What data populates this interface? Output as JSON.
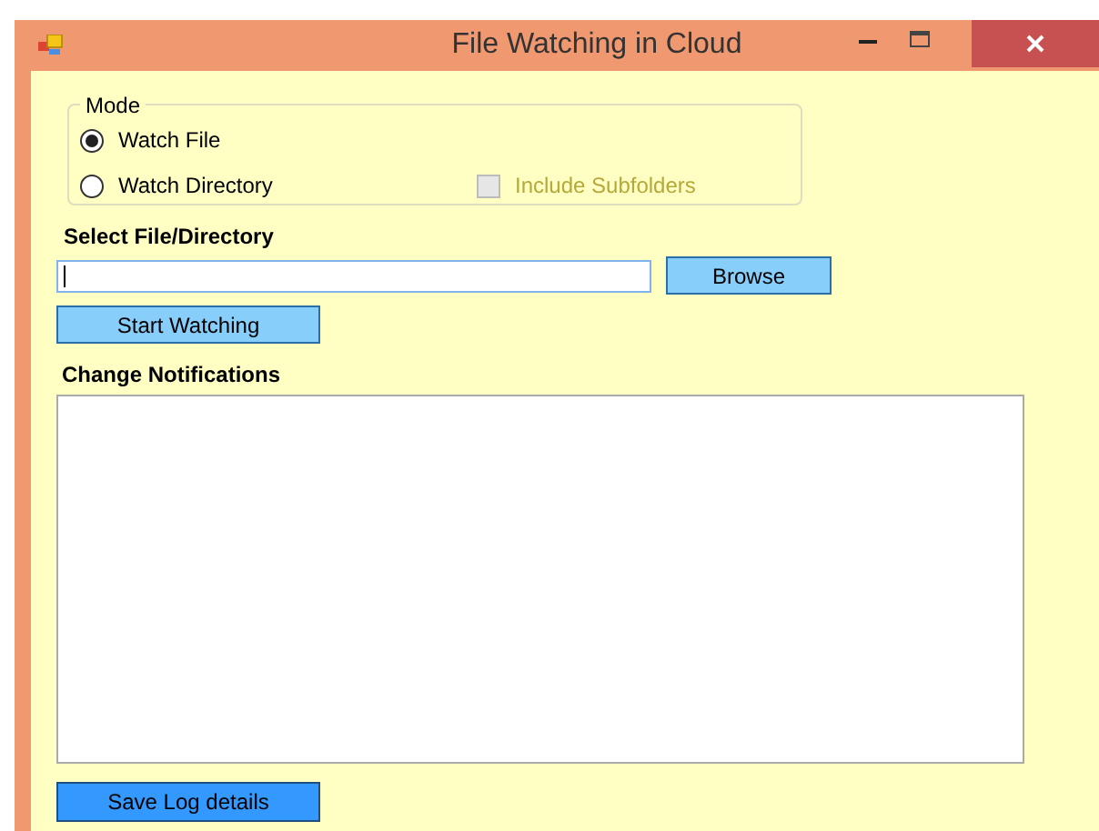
{
  "window": {
    "title": "File Watching in Cloud"
  },
  "mode": {
    "label": "Mode",
    "options": [
      {
        "label": "Watch File",
        "selected": true
      },
      {
        "label": "Watch Directory",
        "selected": false
      }
    ],
    "include_subfolders": {
      "label": "Include Subfolders",
      "checked": false,
      "disabled": true
    }
  },
  "select_label": "Select File/Directory",
  "path_field": {
    "focused": true
  },
  "browse_button": "Browse",
  "start_button": "Start Watching",
  "notifications_label": "Change Notifications",
  "save_button": "Save Log details"
}
